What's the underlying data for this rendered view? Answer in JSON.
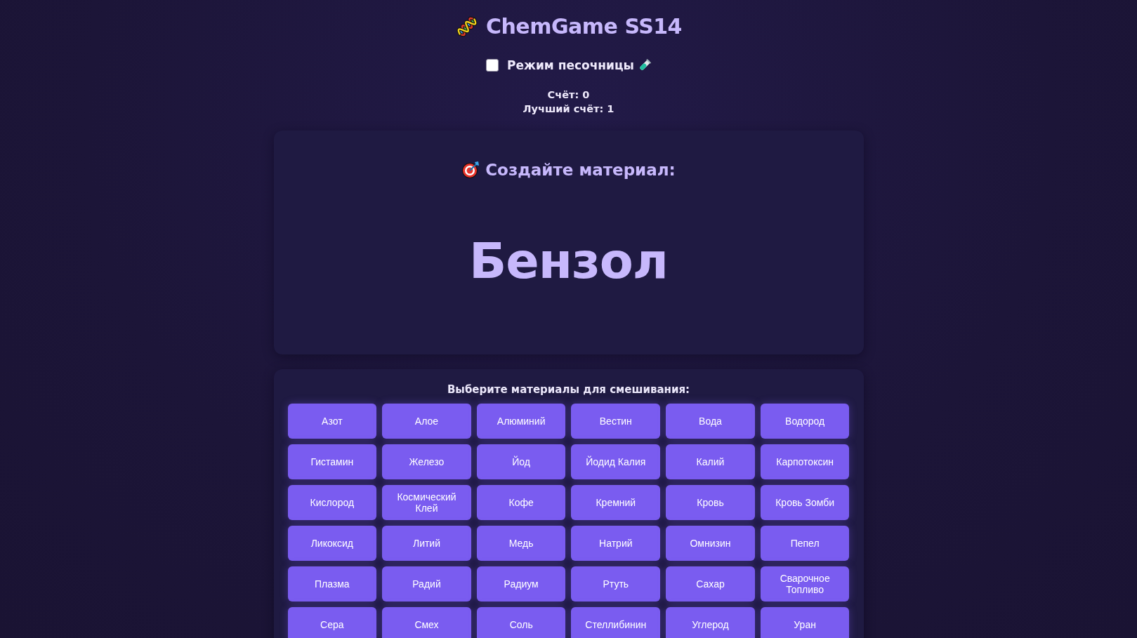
{
  "header": {
    "title": "ChemGame SS14"
  },
  "sandbox_mode": {
    "label": "Режим песочницы",
    "checked": false
  },
  "score": {
    "current": "Счёт: 0",
    "best": "Лучший счёт: 1"
  },
  "target": {
    "heading": "Создайте материал:",
    "material": "Бензол"
  },
  "materials": {
    "heading": "Выберите материалы для смешивания:",
    "items": [
      "Азот",
      "Алое",
      "Алюминий",
      "Вестин",
      "Вода",
      "Водород",
      "Гистамин",
      "Железо",
      "Йод",
      "Йодид Калия",
      "Калий",
      "Карпотоксин",
      "Кислород",
      "Космический Клей",
      "Кофе",
      "Кремний",
      "Кровь",
      "Кровь Зомби",
      "Ликоксид",
      "Литий",
      "Медь",
      "Натрий",
      "Омнизин",
      "Пепел",
      "Плазма",
      "Радий",
      "Радиум",
      "Ртуть",
      "Сахар",
      "Сварочное Топливо",
      "Сера",
      "Смех",
      "Соль",
      "Стеллибинин",
      "Углерод",
      "Уран"
    ]
  }
}
